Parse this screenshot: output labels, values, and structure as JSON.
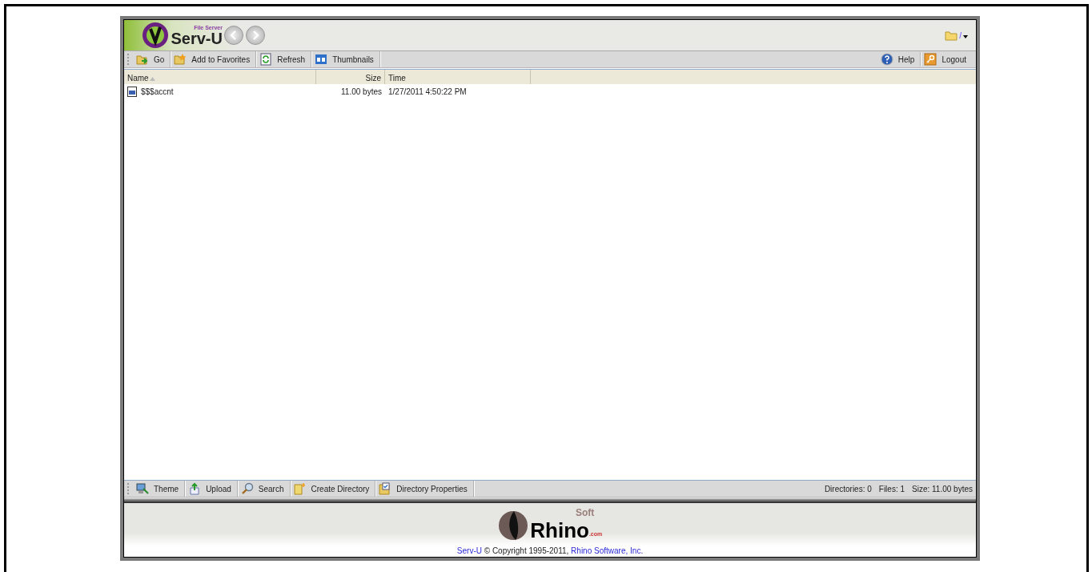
{
  "header": {
    "logo": {
      "tagline": "File Server",
      "name": "Serv-U"
    },
    "path": "/"
  },
  "toolbar": {
    "left": [
      {
        "label": "Go",
        "kind": "go"
      },
      {
        "label": "Add to Favorites",
        "kind": "favorites"
      },
      {
        "label": "Refresh",
        "kind": "refresh"
      },
      {
        "label": "Thumbnails",
        "kind": "thumbnails"
      }
    ],
    "right": [
      {
        "label": "Help",
        "kind": "help"
      },
      {
        "label": "Logout",
        "kind": "logout"
      }
    ]
  },
  "columns": [
    {
      "label": "Name",
      "sorted": true
    },
    {
      "label": "Size",
      "sorted": false
    },
    {
      "label": "Time",
      "sorted": false
    }
  ],
  "rows": [
    {
      "name": "$$$accnt",
      "size": "11.00 bytes",
      "time": "1/27/2011 4:50:22 PM"
    }
  ],
  "bottom_toolbar": [
    {
      "label": "Theme",
      "kind": "theme"
    },
    {
      "label": "Upload",
      "kind": "upload"
    },
    {
      "label": "Search",
      "kind": "search"
    },
    {
      "label": "Create Directory",
      "kind": "newdir"
    },
    {
      "label": "Directory Properties",
      "kind": "dirprops"
    }
  ],
  "status": [
    "Directories: 0",
    "Files: 1",
    "Size: 11.00 bytes"
  ],
  "footer": {
    "logo": {
      "word": "Rhino",
      "sup": "Soft",
      "suffix": ".com"
    },
    "copyright": [
      {
        "kind": "link",
        "text": "Serv-U"
      },
      {
        "kind": "text",
        "text": " © Copyright 1995-2011, "
      },
      {
        "kind": "link",
        "text": "Rhino Software, Inc."
      }
    ]
  }
}
